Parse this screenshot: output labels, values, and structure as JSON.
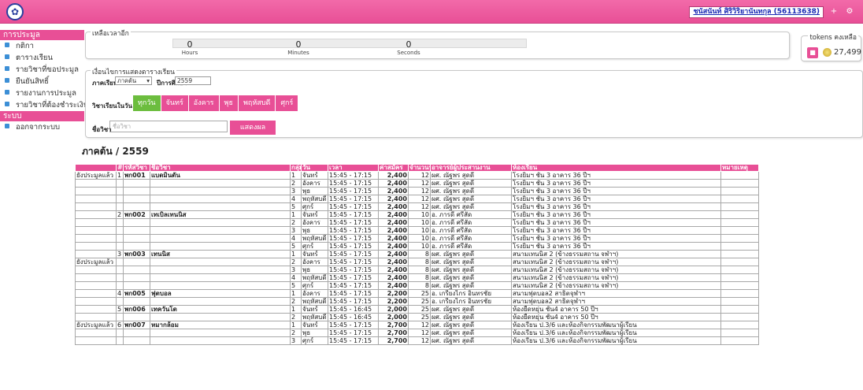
{
  "topbar": {
    "user_name": "ชนัสนันท์ ศิริวิริยานันทกุล (56113638)",
    "icon_add": "+",
    "icon_settings": "⚙"
  },
  "sidebar": {
    "section1": "การประมูล",
    "items1": [
      "กติกา",
      "ตารางเรียน",
      "รายวิชาที่ขอประมูล",
      "ยืนยันสิทธิ์",
      "รายงานการประมูล",
      "รายวิชาที่ต้องชำระเงิน"
    ],
    "section2": "ระบบ",
    "items2": [
      "ออกจากระบบ"
    ]
  },
  "countdown": {
    "legend": "เหลือเวลาอีก",
    "cells": [
      {
        "value": "0",
        "label": "Hours"
      },
      {
        "value": "0",
        "label": "Minutes"
      },
      {
        "value": "0",
        "label": "Seconds"
      }
    ]
  },
  "tokens": {
    "legend": "tokens คงเหลือ",
    "value": "27,499"
  },
  "filters": {
    "legend": "เงื่อนไขการแสดงตารางเรียน",
    "term_label": "ภาคเรียน",
    "term_value": "ภาคต้น",
    "year_label": "ปีการศึกษา",
    "year_value": "2559",
    "day_label": "วิชาเรียนในวัน",
    "days": [
      "ทุกวัน",
      "จันทร์",
      "อังคาร",
      "พุธ",
      "พฤหัสบดี",
      "ศุกร์"
    ],
    "subject_label": "ชื่อวิชา",
    "subject_placeholder": "ชื่อวิชา",
    "show_button": "แสดงผล"
  },
  "section_title": "ภาคต้น / 2559",
  "table": {
    "headers": [
      "",
      "#",
      "รหัสวิชา",
      "ชื่อวิชา",
      "กลุ่ม",
      "วัน",
      "เวลา",
      "ค่าสมัคร",
      "จำนวนรับ",
      "อาจารย์ผู้ประสานงาน",
      "ห้องเรียน",
      "หมายเหตุ"
    ],
    "rows": [
      [
        "ยังประมูลแล้ว",
        "1",
        "พก001",
        "แบดมินตัน",
        "1",
        "จันทร์",
        "15:45 - 17:15",
        "2,400",
        "12",
        "ผศ. ณัฐพร สุดดี",
        "โรงยิมฯ ชั้น 3 อาคาร 36 ปีฯ",
        ""
      ],
      [
        "",
        "",
        "",
        "",
        "2",
        "อังคาร",
        "15:45 - 17:15",
        "2,400",
        "12",
        "ผศ. ณัฐพร สุดดี",
        "โรงยิมฯ ชั้น 3 อาคาร 36 ปีฯ",
        ""
      ],
      [
        "",
        "",
        "",
        "",
        "3",
        "พุธ",
        "15:45 - 17:15",
        "2,400",
        "12",
        "ผศ. ณัฐพร สุดดี",
        "โรงยิมฯ ชั้น 3 อาคาร 36 ปีฯ",
        ""
      ],
      [
        "",
        "",
        "",
        "",
        "4",
        "พฤหัสบดี",
        "15:45 - 17:15",
        "2,400",
        "12",
        "ผศ. ณัฐพร สุดดี",
        "โรงยิมฯ ชั้น 3 อาคาร 36 ปีฯ",
        ""
      ],
      [
        "",
        "",
        "",
        "",
        "5",
        "ศุกร์",
        "15:45 - 17:15",
        "2,400",
        "12",
        "ผศ. ณัฐพร สุดดี",
        "โรงยิมฯ ชั้น 3 อาคาร 36 ปีฯ",
        ""
      ],
      [
        "",
        "2",
        "พก002",
        "เทเบิลเทนนิส",
        "1",
        "จันทร์",
        "15:45 - 17:15",
        "2,400",
        "10",
        "อ. ภารดี ศรีสัด",
        "โรงยิมฯ ชั้น 3 อาคาร 36 ปีฯ",
        ""
      ],
      [
        "",
        "",
        "",
        "",
        "2",
        "อังคาร",
        "15:45 - 17:15",
        "2,400",
        "10",
        "อ. ภารดี ศรีสัด",
        "โรงยิมฯ ชั้น 3 อาคาร 36 ปีฯ",
        ""
      ],
      [
        "",
        "",
        "",
        "",
        "3",
        "พุธ",
        "15:45 - 17:15",
        "2,400",
        "10",
        "อ. ภารดี ศรีสัด",
        "โรงยิมฯ ชั้น 3 อาคาร 36 ปีฯ",
        ""
      ],
      [
        "",
        "",
        "",
        "",
        "4",
        "พฤหัสบดี",
        "15:45 - 17:15",
        "2,400",
        "10",
        "อ. ภารดี ศรีสัด",
        "โรงยิมฯ ชั้น 3 อาคาร 36 ปีฯ",
        ""
      ],
      [
        "",
        "",
        "",
        "",
        "5",
        "ศุกร์",
        "15:45 - 17:15",
        "2,400",
        "10",
        "อ. ภารดี ศรีสัด",
        "โรงยิมฯ ชั้น 3 อาคาร 36 ปีฯ",
        ""
      ],
      [
        "",
        "3",
        "พก003",
        "เทนนิส",
        "1",
        "จันทร์",
        "15:45 - 17:15",
        "2,400",
        "8",
        "ผศ. ณัฐพร สุดดี",
        "สนามเทนนิส 2 (ข้างธรรมสถาน จฬาฯ)",
        ""
      ],
      [
        "ยังประมูลแล้ว",
        "",
        "",
        "",
        "2",
        "อังคาร",
        "15:45 - 17:15",
        "2,400",
        "8",
        "ผศ. ณัฐพร สุดดี",
        "สนามเทนนิส 2 (ข้างธรรมสถาน จฬาฯ)",
        ""
      ],
      [
        "",
        "",
        "",
        "",
        "3",
        "พุธ",
        "15:45 - 17:15",
        "2,400",
        "8",
        "ผศ. ณัฐพร สุดดี",
        "สนามเทนนิส 2 (ข้างธรรมสถาน จฬาฯ)",
        ""
      ],
      [
        "",
        "",
        "",
        "",
        "4",
        "พฤหัสบดี",
        "15:45 - 17:15",
        "2,400",
        "8",
        "ผศ. ณัฐพร สุดดี",
        "สนามเทนนิส 2 (ข้างธรรมสถาน จฬาฯ)",
        ""
      ],
      [
        "",
        "",
        "",
        "",
        "5",
        "ศุกร์",
        "15:45 - 17:15",
        "2,400",
        "8",
        "ผศ. ณัฐพร สุดดี",
        "สนามเทนนิส 2 (ข้างธรรมสถาน จฬาฯ)",
        ""
      ],
      [
        "",
        "4",
        "พก005",
        "ฟุตบอล",
        "1",
        "อังคาร",
        "15:45 - 17:15",
        "2,200",
        "25",
        "อ. เกรียงไกร อินทรชัย",
        "สนามฟุตบอล2 สาธิตจุฬาฯ",
        ""
      ],
      [
        "",
        "",
        "",
        "",
        "2",
        "พฤหัสบดี",
        "15:45 - 17:15",
        "2,200",
        "25",
        "อ. เกรียงไกร อินทรชัย",
        "สนามฟุตบอล2 สาธิตจุฬาฯ",
        ""
      ],
      [
        "",
        "5",
        "พก006",
        "เทควันโด",
        "1",
        "จันทร์",
        "15:45 - 16:45",
        "2,000",
        "25",
        "ผศ. ณัฐพร สุดดี",
        "ห้องยืดหยุ่น ชั้น4 อาคาร 50 ปีฯ",
        ""
      ],
      [
        "",
        "",
        "",
        "",
        "2",
        "พฤหัสบดี",
        "15:45 - 16:45",
        "2,000",
        "25",
        "ผศ. ณัฐพร สุดดี",
        "ห้องยืดหยุ่น ชั้น4 อาคาร 50 ปีฯ",
        ""
      ],
      [
        "ยังประมูลแล้ว",
        "6",
        "พก007",
        "หมากล้อม",
        "1",
        "จันทร์",
        "15:45 - 17:15",
        "2,700",
        "12",
        "ผศ. ณัฐพร สุดดี",
        "ห้องเรียน ป.3/6 และห้องกิจกรรมพัฒนาผู้เรียน",
        ""
      ],
      [
        "",
        "",
        "",
        "",
        "2",
        "พุธ",
        "15:45 - 17:15",
        "2,700",
        "12",
        "ผศ. ณัฐพร สุดดี",
        "ห้องเรียน ป.3/6 และห้องกิจกรรมพัฒนาผู้เรียน",
        ""
      ],
      [
        "",
        "",
        "",
        "",
        "3",
        "ศุกร์",
        "15:45 - 17:15",
        "2,700",
        "12",
        "ผศ. ณัฐพร สุดดี",
        "ห้องเรียน ป.3/6 และห้องกิจกรรมพัฒนาผู้เรียน",
        ""
      ]
    ]
  },
  "colors": {
    "accent": "#e84f96",
    "active_tab": "#6cbd3e",
    "link": "#1f24c9"
  }
}
